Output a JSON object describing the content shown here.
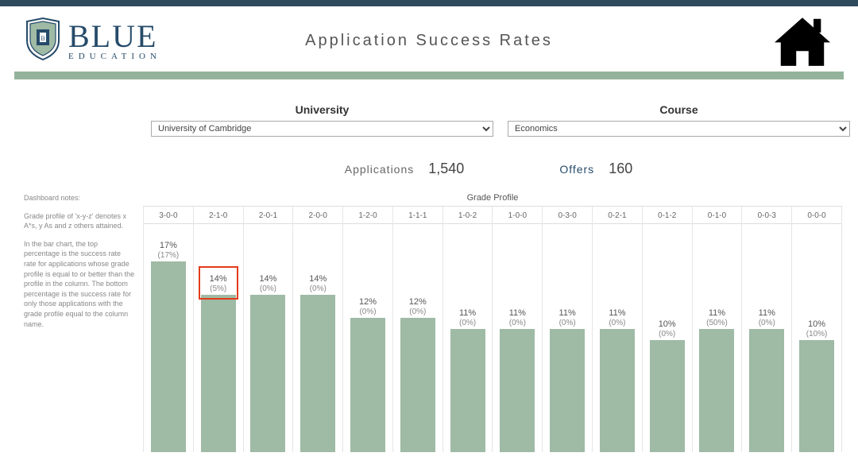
{
  "brand": {
    "name": "BLUE",
    "sub": "EDUCATION"
  },
  "page_title": "Application Success Rates",
  "filters": {
    "university": {
      "label": "University",
      "selected": "University of Cambridge"
    },
    "course": {
      "label": "Course",
      "selected": "Economics"
    }
  },
  "stats": {
    "applications": {
      "label": "Applications",
      "value": "1,540"
    },
    "offers": {
      "label": "Offers",
      "value": "160"
    }
  },
  "notes": {
    "heading": "Dashboard notes:",
    "p1": "Grade profile of 'x-y-z' denotes x A*s, y As and z others attained.",
    "p2": "In the bar chart, the top percentage is the success rate rate for applications whose grade profile is equal to or better than the profile in the column. The bottom percentage is the success rate for only those applications with the grade profile equal to the column name."
  },
  "chart_title": "Grade Profile",
  "chart_data": {
    "type": "bar",
    "title": "Grade Profile",
    "xlabel": "",
    "ylabel": "",
    "ylim": [
      0,
      17
    ],
    "categories": [
      "3-0-0",
      "2-1-0",
      "2-0-1",
      "2-0-0",
      "1-2-0",
      "1-1-1",
      "1-0-2",
      "1-0-0",
      "0-3-0",
      "0-2-1",
      "0-1-2",
      "0-1-0",
      "0-0-3",
      "0-0-0"
    ],
    "series": [
      {
        "name": "Cumulative success rate (%)",
        "values": [
          17,
          14,
          14,
          14,
          12,
          12,
          11,
          11,
          11,
          11,
          10,
          11,
          11,
          10
        ]
      },
      {
        "name": "Exact-profile success rate (%)",
        "values": [
          17,
          5,
          0,
          0,
          0,
          0,
          0,
          0,
          0,
          0,
          0,
          50,
          0,
          10
        ]
      }
    ],
    "highlight_index": 1
  }
}
